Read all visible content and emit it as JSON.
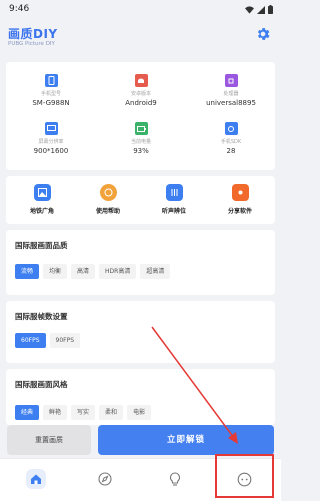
{
  "status_bar": {
    "time": "9:46"
  },
  "header": {
    "title": "画质DIY",
    "subtitle": "PUBG Picture DIY"
  },
  "device_info": [
    {
      "icon": "phone-icon",
      "label": "手机型号",
      "value": "SM-G988N",
      "color": "#3d7ff0"
    },
    {
      "icon": "android-icon",
      "label": "安卓版本",
      "value": "Android9",
      "color": "#e55b4d"
    },
    {
      "icon": "cpu-icon",
      "label": "处理器",
      "value": "universal8895",
      "color": "#9a57e0"
    },
    {
      "icon": "screen-icon",
      "label": "屏幕分辨率",
      "value": "900*1600",
      "color": "#3d7ff0"
    },
    {
      "icon": "battery-icon",
      "label": "当前电量",
      "value": "93%",
      "color": "#3bb26a"
    },
    {
      "icon": "sdk-icon",
      "label": "手机SDK",
      "value": "28",
      "color": "#3d7ff0"
    }
  ],
  "tools": [
    {
      "icon": "image-icon",
      "label": "地铁广角",
      "color": "#3d7ff0"
    },
    {
      "icon": "help-icon",
      "label": "使用帮助",
      "color": "#f2a23a"
    },
    {
      "icon": "equalizer-icon",
      "label": "听声辨位",
      "color": "#3d7ff0"
    },
    {
      "icon": "share-icon",
      "label": "分享软件",
      "color": "#f26a2b"
    }
  ],
  "quality_section": {
    "title": "国际服画面品质",
    "options": [
      "流畅",
      "均衡",
      "高清",
      "HDR高清",
      "超高清"
    ],
    "selected": "流畅"
  },
  "fps_section": {
    "title": "国际服帧数设置",
    "options": [
      "60FPS",
      "90FPS"
    ],
    "selected": "60FPS"
  },
  "style_section": {
    "title": "国际服画面风格",
    "options": [
      "经典",
      "鲜艳",
      "写实",
      "柔和",
      "电影"
    ],
    "selected": "经典"
  },
  "buttons": {
    "reset": "重置画质",
    "apply": "立即解锁"
  },
  "bottom_nav": [
    "home-icon",
    "compass-icon",
    "bulb-icon",
    "more-icon"
  ],
  "colors": {
    "accent": "#4480ef",
    "highlight": "#e53935"
  }
}
